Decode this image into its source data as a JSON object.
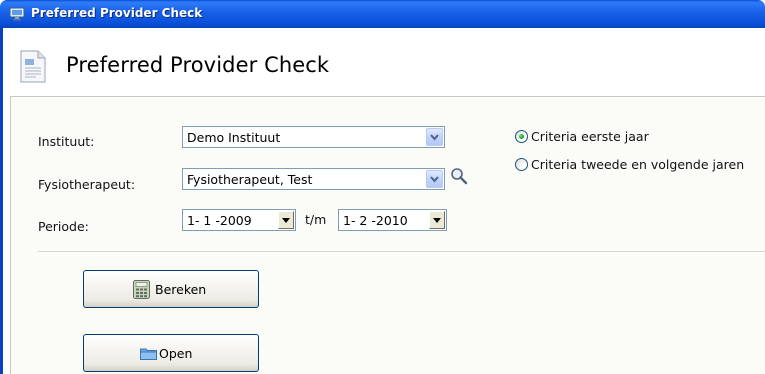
{
  "window": {
    "title": "Preferred Provider Check",
    "app_icon": "monitor-icon",
    "title_bar_color": "#0a4fd8"
  },
  "header": {
    "heading": "Preferred Provider Check",
    "icon": "document-icon"
  },
  "form": {
    "instituut": {
      "label": "Instituut:",
      "value": "Demo Instituut"
    },
    "fysiotherapeut": {
      "label": "Fysiotherapeut:",
      "value": "Fysiotherapeut, Test",
      "search_icon": "magnifier-icon"
    },
    "periode": {
      "label": "Periode:",
      "from": "1- 1 -2009",
      "separator": "t/m",
      "to": "1- 2 -2010"
    },
    "criteria": {
      "options": [
        {
          "label": "Criteria eerste jaar",
          "selected": true
        },
        {
          "label": "Criteria tweede en volgende jaren",
          "selected": false
        }
      ]
    }
  },
  "buttons": {
    "bereken": {
      "label": "Bereken",
      "icon": "calculator-icon"
    },
    "open": {
      "label": "Open",
      "icon": "folder-icon"
    }
  }
}
